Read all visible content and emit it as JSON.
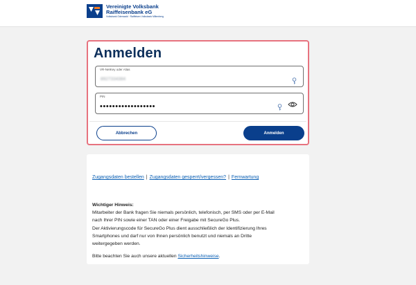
{
  "header": {
    "bank_name_line1": "Vereinigte Volksbank",
    "bank_name_line2": "Raiffeisenbank eG",
    "bank_subline": "Volksbank Odenwald · Raiffeisen Volksbank Miltenberg",
    "brand_color": "#0a3f8c",
    "accent_color": "#f47b20"
  },
  "login": {
    "title": "Anmelden",
    "username_label": "VR-NetKey oder Alias",
    "username_value": "8927334384",
    "pin_label": "PIN",
    "pin_value": "••••••••••••••••••",
    "cancel_label": "Abbrechen",
    "submit_label": "Anmelden",
    "highlight_color": "#e7727e"
  },
  "info": {
    "links": [
      {
        "label": "Zugangsdaten bestellen"
      },
      {
        "label": "Zugangsdaten gesperrt/vergessen?"
      },
      {
        "label": "Fernwartung"
      }
    ],
    "separator": "|",
    "notice_title": "Wichtiger Hinweis:",
    "notice_lines": [
      "Mitarbeiter der Bank fragen Sie niemals persönlich, telefonisch, per SMS oder per E-Mail",
      "nach Ihrer PIN sowie einer TAN oder einer Freigabe mit SecureGo Plus.",
      "Der Aktivierungscode für SecureGo Plus dient ausschließlich der Identifizierung Ihres",
      "Smartphones und darf nur von Ihnen persönlich benutzt und niemals an Dritte",
      "weitergegeben werden."
    ],
    "hint_prefix": "Bitte beachten Sie auch unsere aktuellen ",
    "hint_link": "Sicherheitshinweise",
    "hint_suffix": "."
  }
}
